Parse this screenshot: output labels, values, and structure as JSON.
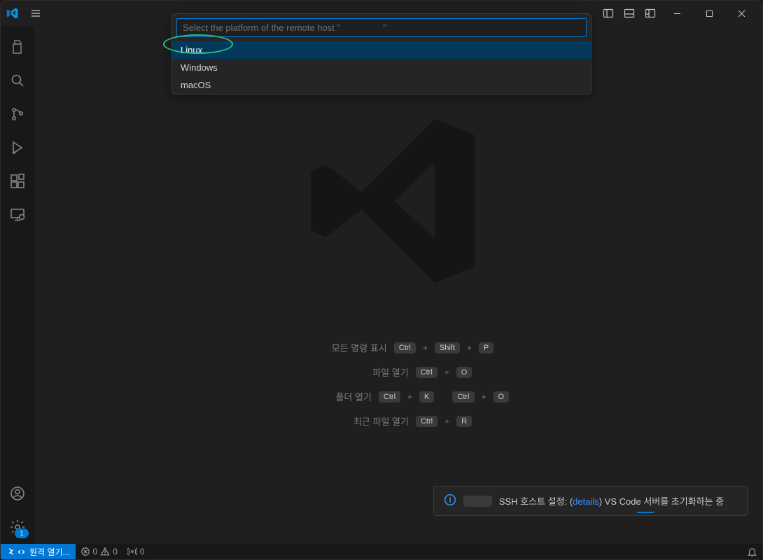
{
  "titlebar": {
    "layout_groups": [
      "layout-primary-side",
      "layout-panel",
      "layout-customize"
    ]
  },
  "quickInput": {
    "placeholder_prefix": "Select the platform of the remote host \"",
    "placeholder_suffix": "\"",
    "options": [
      "Linux",
      "Windows",
      "macOS"
    ],
    "selected_index": 0
  },
  "activity": {
    "gear_badge": "1"
  },
  "shortcuts": {
    "rows": [
      {
        "label": "모든 명령 표시",
        "keys": [
          "Ctrl",
          "Shift",
          "P"
        ]
      },
      {
        "label": "파일 열기",
        "keys": [
          "Ctrl",
          "O"
        ]
      },
      {
        "label": "폴더 열기",
        "keys": [
          "Ctrl",
          "K",
          "Ctrl",
          "O"
        ],
        "split": 2
      },
      {
        "label": "최근 파일 열기",
        "keys": [
          "Ctrl",
          "R"
        ]
      }
    ]
  },
  "notification": {
    "prefix": "SSH 호스트 설정: (",
    "details": "details",
    "suffix": ") VS Code 서버를 초기화하는 중"
  },
  "statusbar": {
    "remote_label": "원격 열기...",
    "problems_err": "0",
    "problems_warn": "0",
    "ports": "0"
  }
}
